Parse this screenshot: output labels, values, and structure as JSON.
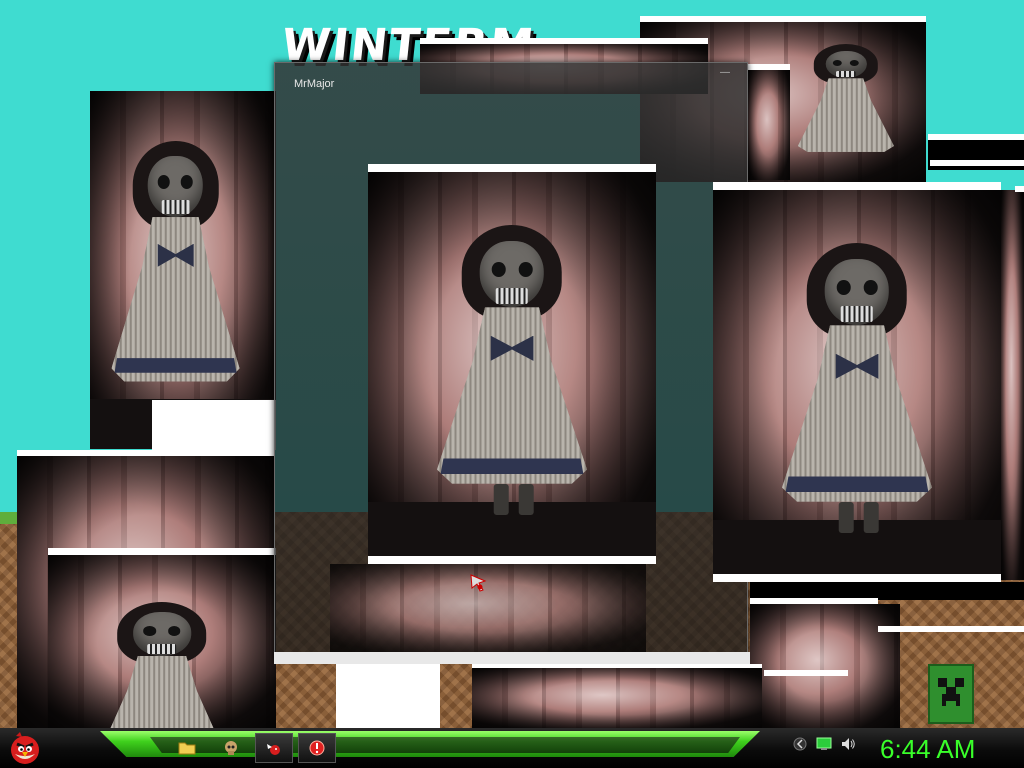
{
  "desktop": {
    "logo_text": "WINTERM",
    "background_color": "#3fdcd0"
  },
  "window": {
    "title": "MrMajor",
    "minimize_glyph": "—"
  },
  "taskbar": {
    "start_icon": "angry-bird-red-icon",
    "items": [
      {
        "icon": "folder-icon",
        "active": false
      },
      {
        "icon": "skull-icon",
        "active": false
      },
      {
        "icon": "angry-bird-icon",
        "active": true
      },
      {
        "icon": "red-circle-app-icon",
        "active": true
      }
    ],
    "tray_icons": [
      "chevron-left-icon",
      "network-monitor-icon",
      "speaker-volume-icon"
    ],
    "clock": "6:44 AM",
    "accent_color": "#39ff2a"
  }
}
